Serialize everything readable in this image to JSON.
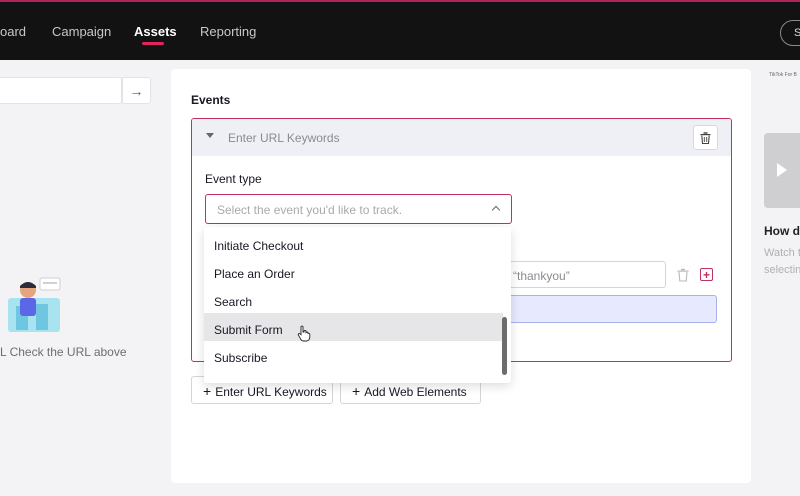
{
  "nav": {
    "items": [
      {
        "label": "oard"
      },
      {
        "label": "Campaign"
      },
      {
        "label": "Assets"
      },
      {
        "label": "Reporting"
      }
    ],
    "right_pill": "S"
  },
  "left": {
    "hint": "L Check the URL above"
  },
  "events": {
    "title": "Events",
    "card_header": "Enter URL Keywords",
    "event_type_label": "Event type",
    "select_placeholder": "Select the event you'd like to track.",
    "options": [
      "Initiate Checkout",
      "Place an Order",
      "Search",
      "Submit Form",
      "Subscribe"
    ],
    "hovered_option": "Submit Form",
    "keyword_value": "“thankyou”"
  },
  "buttons": {
    "add_url_keywords": "Enter URL Keywords",
    "add_web_elements": "Add Web Elements"
  },
  "right": {
    "logo": "TikTok For B",
    "title": "How do",
    "sub1": "Watch t",
    "sub2": "selectin"
  },
  "colors": {
    "accent": "#c2305f",
    "topbar": "#121212",
    "active_underline": "#e0245e"
  }
}
